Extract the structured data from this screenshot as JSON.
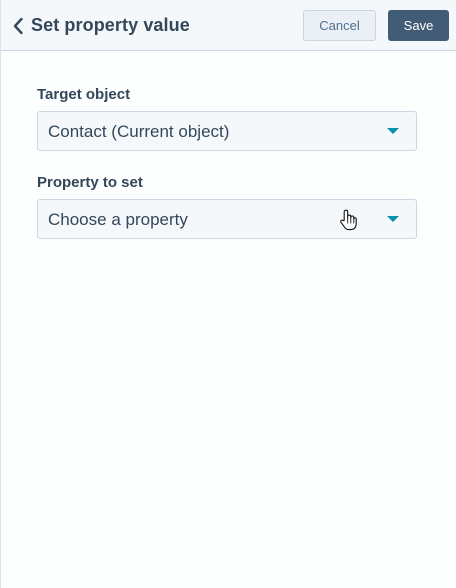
{
  "header": {
    "title": "Set property value",
    "cancel_label": "Cancel",
    "save_label": "Save"
  },
  "form": {
    "target_object": {
      "label": "Target object",
      "value": "Contact (Current object)"
    },
    "property_to_set": {
      "label": "Property to set",
      "value": "Choose a property"
    }
  },
  "icons": {
    "back": "chevron-left-icon",
    "dropdown": "caret-down-icon",
    "cursor": "hand-pointer-icon"
  },
  "colors": {
    "header_bg": "#f5f8fa",
    "text": "#33475b",
    "save_bg": "#425b76",
    "cancel_bg": "#eaf0f6",
    "caret": "#0091ae",
    "border": "#cbd6e2"
  }
}
